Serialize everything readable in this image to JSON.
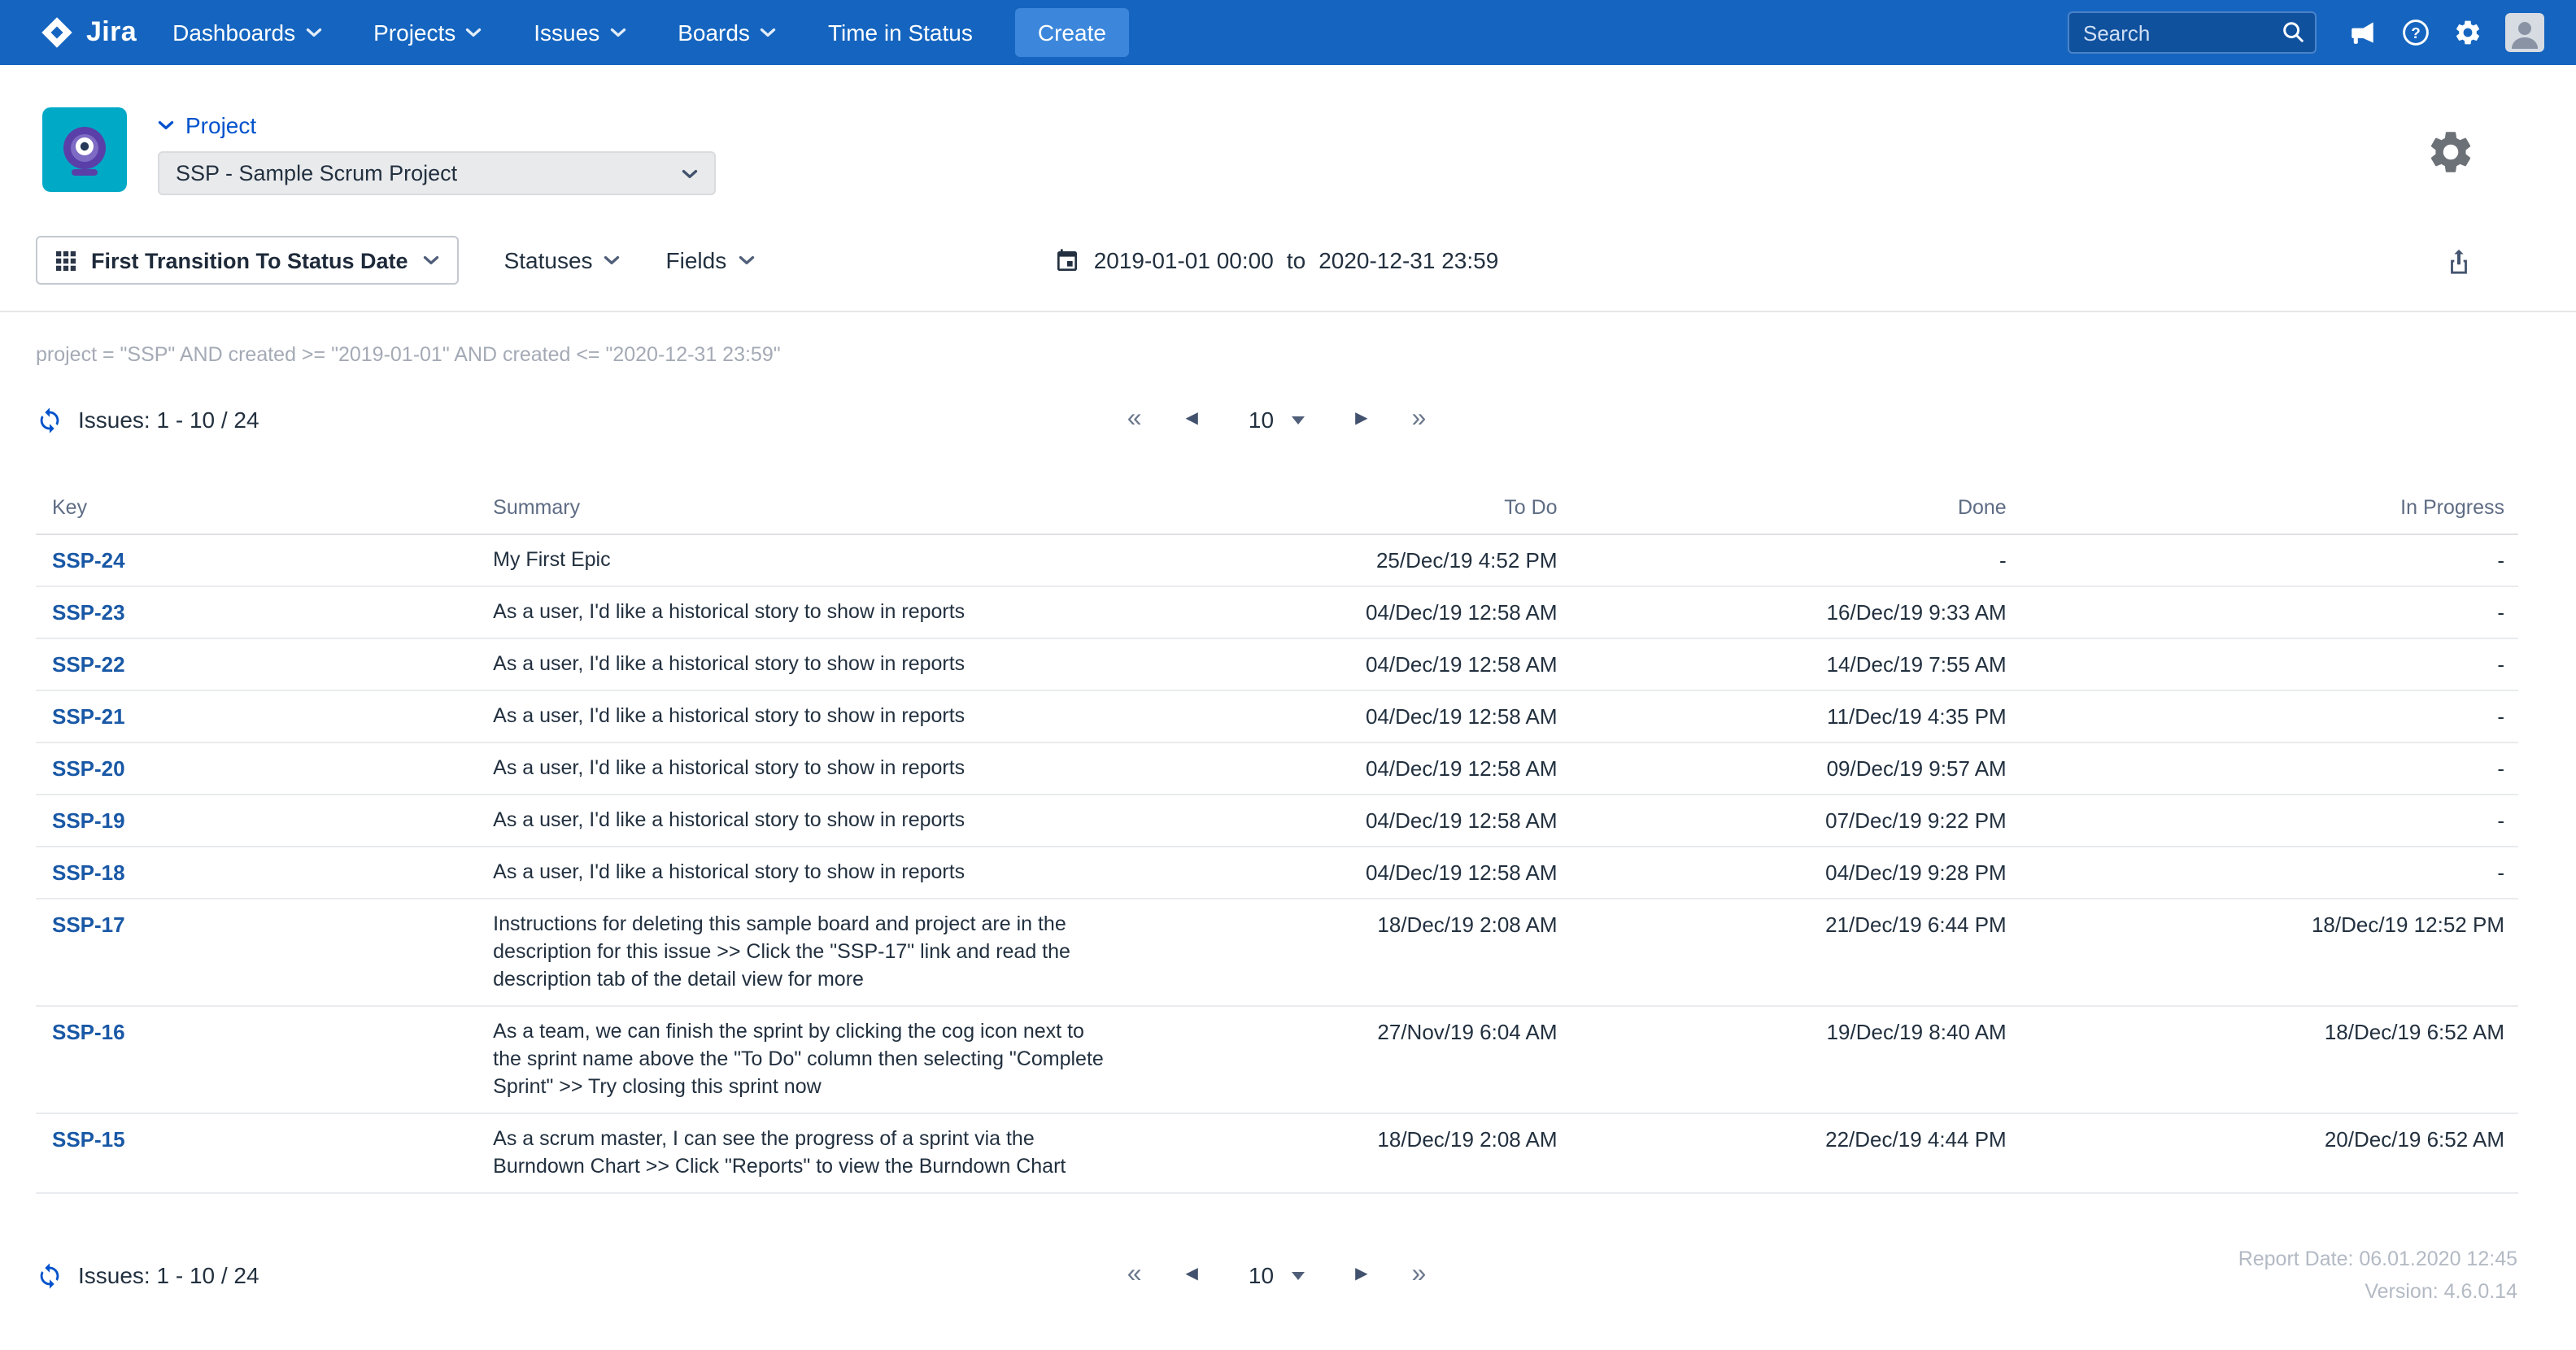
{
  "colors": {
    "navbar-bg": "#1565C0",
    "create-bg": "#3C87DB",
    "search-bg": "#10519E",
    "search-border": "#4A83C9",
    "accent": "#0052CC",
    "key-link": "#1958A6"
  },
  "navbar": {
    "brand": "Jira",
    "items": [
      {
        "label": "Dashboards"
      },
      {
        "label": "Projects"
      },
      {
        "label": "Issues"
      },
      {
        "label": "Boards"
      },
      {
        "label": "Time in Status"
      }
    ],
    "create_label": "Create",
    "search_placeholder": "Search"
  },
  "project_header": {
    "label": "Project",
    "selected_project": "SSP - Sample Scrum Project"
  },
  "toolbar": {
    "report_type_label": "First Transition To Status Date",
    "statuses_label": "Statuses",
    "fields_label": "Fields",
    "date_from": "2019-01-01 00:00",
    "date_separator": "to",
    "date_to": "2020-12-31 23:59"
  },
  "query_text": "project = \"SSP\" AND created >= \"2019-01-01\" AND created <= \"2020-12-31 23:59\"",
  "pagination": {
    "issues_summary": "Issues: 1 - 10 / 24",
    "first": "«",
    "prev": "◀",
    "page_size": "10",
    "next": "▶",
    "last": "»"
  },
  "table": {
    "columns": {
      "key": "Key",
      "summary": "Summary",
      "todo": "To Do",
      "done": "Done",
      "in_progress": "In Progress"
    },
    "rows": [
      {
        "key": "SSP-24",
        "summary": "My First Epic",
        "todo": "25/Dec/19 4:52 PM",
        "done": "-",
        "in_progress": "-"
      },
      {
        "key": "SSP-23",
        "summary": "As a user, I'd like a historical story to show in reports",
        "todo": "04/Dec/19 12:58 AM",
        "done": "16/Dec/19 9:33 AM",
        "in_progress": "-"
      },
      {
        "key": "SSP-22",
        "summary": "As a user, I'd like a historical story to show in reports",
        "todo": "04/Dec/19 12:58 AM",
        "done": "14/Dec/19 7:55 AM",
        "in_progress": "-"
      },
      {
        "key": "SSP-21",
        "summary": "As a user, I'd like a historical story to show in reports",
        "todo": "04/Dec/19 12:58 AM",
        "done": "11/Dec/19 4:35 PM",
        "in_progress": "-"
      },
      {
        "key": "SSP-20",
        "summary": "As a user, I'd like a historical story to show in reports",
        "todo": "04/Dec/19 12:58 AM",
        "done": "09/Dec/19 9:57 AM",
        "in_progress": "-"
      },
      {
        "key": "SSP-19",
        "summary": "As a user, I'd like a historical story to show in reports",
        "todo": "04/Dec/19 12:58 AM",
        "done": "07/Dec/19 9:22 PM",
        "in_progress": "-"
      },
      {
        "key": "SSP-18",
        "summary": "As a user, I'd like a historical story to show in reports",
        "todo": "04/Dec/19 12:58 AM",
        "done": "04/Dec/19 9:28 PM",
        "in_progress": "-"
      },
      {
        "key": "SSP-17",
        "summary": "Instructions for deleting this sample board and project are in the description for this issue >> Click the \"SSP-17\" link and read the description tab of the detail view for more",
        "todo": "18/Dec/19 2:08 AM",
        "done": "21/Dec/19 6:44 PM",
        "in_progress": "18/Dec/19 12:52 PM"
      },
      {
        "key": "SSP-16",
        "summary": "As a team, we can finish the sprint by clicking the cog icon next to the sprint name above the \"To Do\" column then selecting \"Complete Sprint\" >> Try closing this sprint now",
        "todo": "27/Nov/19 6:04 AM",
        "done": "19/Dec/19 8:40 AM",
        "in_progress": "18/Dec/19 6:52 AM"
      },
      {
        "key": "SSP-15",
        "summary": "As a scrum master, I can see the progress of a sprint via the Burndown Chart >> Click \"Reports\" to view the Burndown Chart",
        "todo": "18/Dec/19 2:08 AM",
        "done": "22/Dec/19 4:44 PM",
        "in_progress": "20/Dec/19 6:52 AM"
      }
    ]
  },
  "footer": {
    "report_date": "Report Date: 06.01.2020 12:45",
    "version": "Version: 4.6.0.14"
  }
}
